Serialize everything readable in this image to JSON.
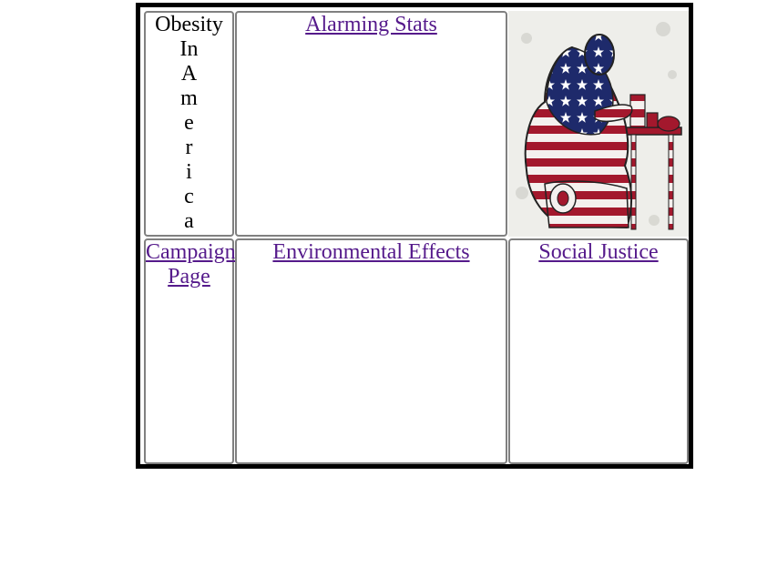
{
  "title": {
    "lines": [
      "Obesity",
      "In",
      "A",
      "m",
      "e",
      "r",
      "i",
      "c",
      "a"
    ]
  },
  "links": {
    "alarming_stats": "Alarming Stats",
    "campaign_page_line1": "Campaign",
    "campaign_page_line2": "Page",
    "environmental_effects": "Environmental Effects",
    "social_justice": "Social Justice"
  },
  "image": {
    "icon": "obese-man-american-flag-illustration"
  },
  "colors": {
    "link": "#551a8b",
    "frame": "#000000",
    "cell_border": "#808080",
    "flag_red": "#a3182d",
    "flag_blue": "#1e2a6b"
  }
}
